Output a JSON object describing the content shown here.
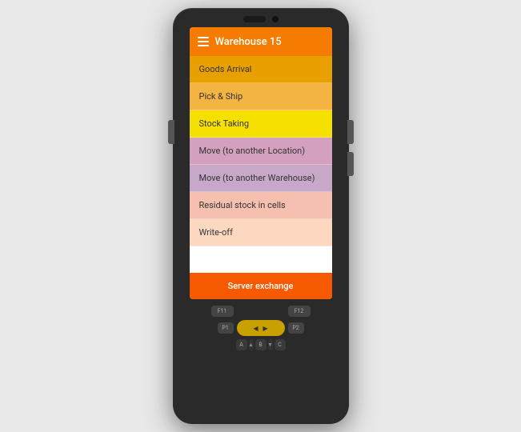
{
  "header": {
    "title": "Warehouse 15",
    "menu_icon": "hamburger"
  },
  "menu": {
    "items": [
      {
        "id": 1,
        "label": "Goods Arrival",
        "color_class": "menu-item-1"
      },
      {
        "id": 2,
        "label": "Pick & Ship",
        "color_class": "menu-item-2"
      },
      {
        "id": 3,
        "label": "Stock Taking",
        "color_class": "menu-item-3"
      },
      {
        "id": 4,
        "label": "Move (to another Location)",
        "color_class": "menu-item-4"
      },
      {
        "id": 5,
        "label": "Move (to another Warehouse)",
        "color_class": "menu-item-5"
      },
      {
        "id": 6,
        "label": "Residual stock in cells",
        "color_class": "menu-item-6"
      },
      {
        "id": 7,
        "label": "Write-off",
        "color_class": "menu-item-7"
      }
    ],
    "server_exchange_label": "Server exchange"
  },
  "keypad": {
    "f11_label": "F11",
    "f12_label": "F12",
    "p1_label": "P1",
    "p2_label": "P2",
    "letters": [
      "A",
      "B",
      "C"
    ]
  }
}
